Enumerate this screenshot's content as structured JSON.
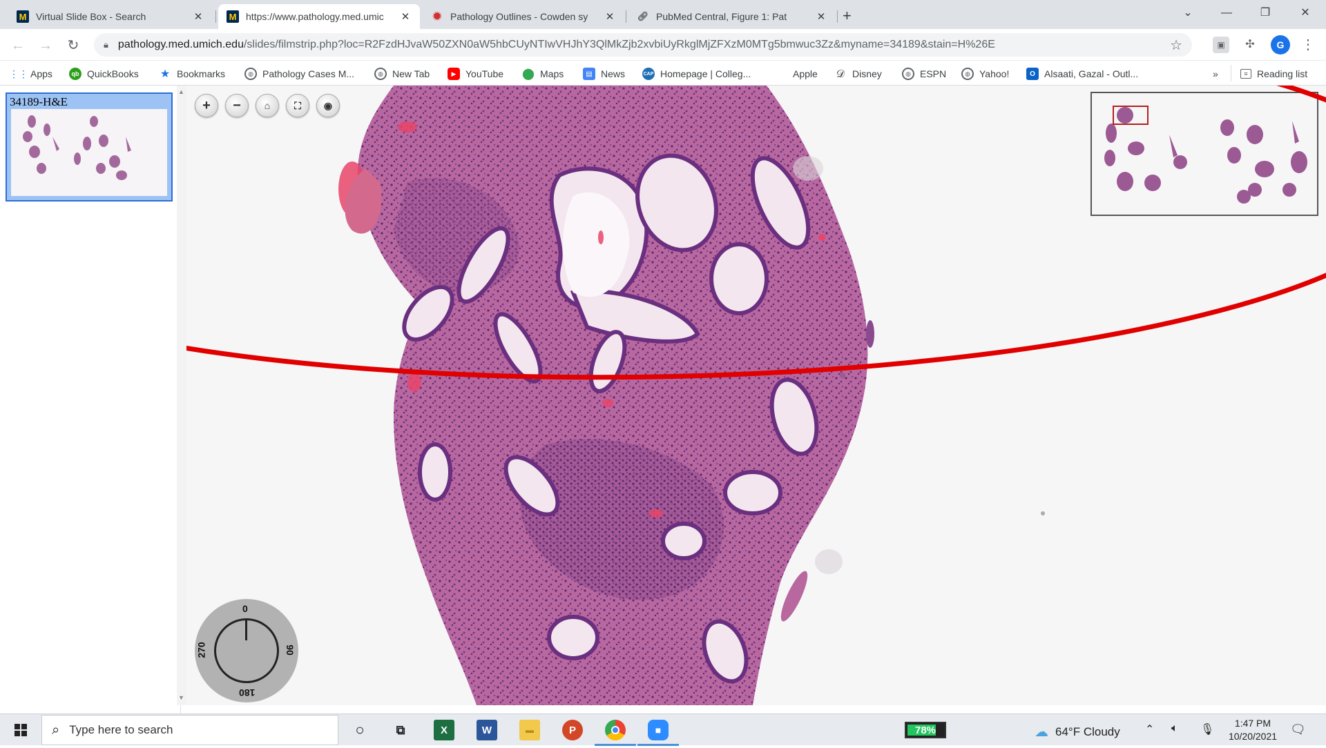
{
  "browser": {
    "tabs": [
      {
        "title": "Virtual Slide Box - Search",
        "favicon": "michigan-m-icon",
        "active": false
      },
      {
        "title": "https://www.pathology.med.umic",
        "favicon": "michigan-m-icon",
        "active": true
      },
      {
        "title": "Pathology Outlines - Cowden sy",
        "favicon": "pathology-outlines-icon",
        "active": false
      },
      {
        "title": "PubMed Central, Figure 1: Pat",
        "favicon": "pubmed-link-icon",
        "active": false
      }
    ],
    "favicon_letter": "M",
    "new_tab_glyph": "+",
    "url_host": "pathology.med.umich.edu",
    "url_path": "/slides/filmstrip.php?loc=R2FzdHJvaW50ZXN0aW5hbCUyNTIwVHJhY3QlMkZjb2xvbiUyRkglMjZFXzM0MTg5bmwuc3Zz&myname=34189&stain=H%26E",
    "profile_initial": "G",
    "reading_list": "Reading list",
    "bookmarks_overflow": "»"
  },
  "bookmarks": [
    {
      "label": "Apps",
      "icon": "apps-grid-icon"
    },
    {
      "label": "QuickBooks",
      "icon": "quickbooks-icon"
    },
    {
      "label": "Bookmarks",
      "icon": "star-icon"
    },
    {
      "label": "Pathology Cases M...",
      "icon": "globe-icon"
    },
    {
      "label": "New Tab",
      "icon": "globe-icon"
    },
    {
      "label": "YouTube",
      "icon": "youtube-icon"
    },
    {
      "label": "Maps",
      "icon": "maps-pin-icon"
    },
    {
      "label": "News",
      "icon": "news-icon"
    },
    {
      "label": "Homepage | Colleg...",
      "icon": "cap-icon"
    },
    {
      "label": "Apple",
      "icon": "apple-icon"
    },
    {
      "label": "Disney",
      "icon": "disney-icon"
    },
    {
      "label": "ESPN",
      "icon": "globe-icon"
    },
    {
      "label": "Yahoo!",
      "icon": "globe-icon"
    },
    {
      "label": "Alsaati, Gazal - Outl...",
      "icon": "outlook-icon"
    }
  ],
  "viewer": {
    "slide_label": "34189-H&E",
    "controls": [
      "zoom-in",
      "zoom-out",
      "home",
      "fullscreen",
      "screenshot"
    ],
    "rotation": {
      "top": "0",
      "right": "90",
      "bottom": "180",
      "left": "270",
      "angle": 0
    },
    "annotation_color": "#e00000",
    "stain_colors": {
      "tissue": "#b05a9c",
      "nuclei": "#5a2a72",
      "stroma": "#d995c2",
      "blood": "#e8456a",
      "background": "#f7f6f7"
    }
  },
  "taskbar": {
    "search_placeholder": "Type here to search",
    "battery_percent": "78%",
    "battery_level": 0.78,
    "weather": "64°F  Cloudy",
    "time": "1:47 PM",
    "date": "10/20/2021",
    "apps": [
      "cortana-icon",
      "task-view-icon",
      "excel-icon",
      "word-icon",
      "file-explorer-icon",
      "powerpoint-icon",
      "chrome-icon",
      "zoom-icon"
    ]
  }
}
